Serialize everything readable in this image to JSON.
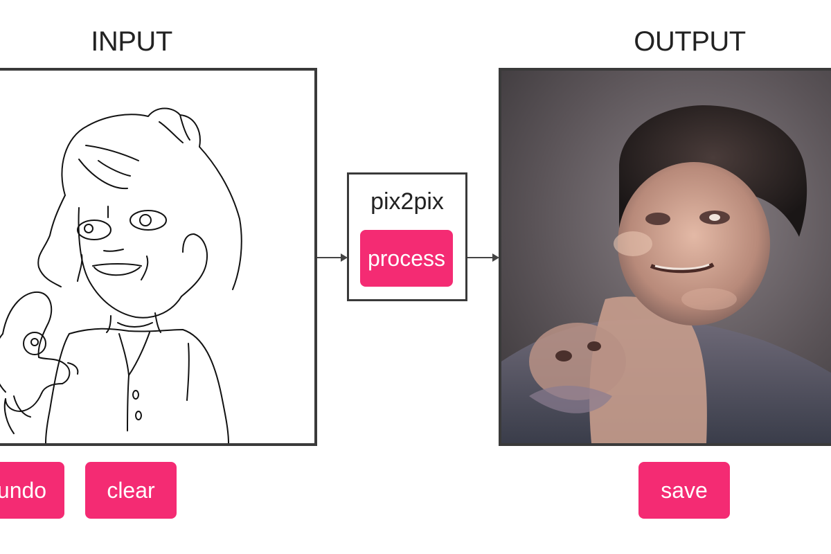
{
  "input": {
    "heading": "INPUT",
    "undo_label": "undo",
    "clear_label": "clear"
  },
  "model": {
    "name": "pix2pix",
    "process_label": "process"
  },
  "output": {
    "heading": "OUTPUT",
    "save_label": "save"
  },
  "colors": {
    "accent": "#f42b73",
    "border": "#3a3a3a",
    "text": "#222222",
    "output_background": "#4f4a4e"
  },
  "icons": [
    "arrow-right-icon",
    "arrow-right-icon"
  ]
}
